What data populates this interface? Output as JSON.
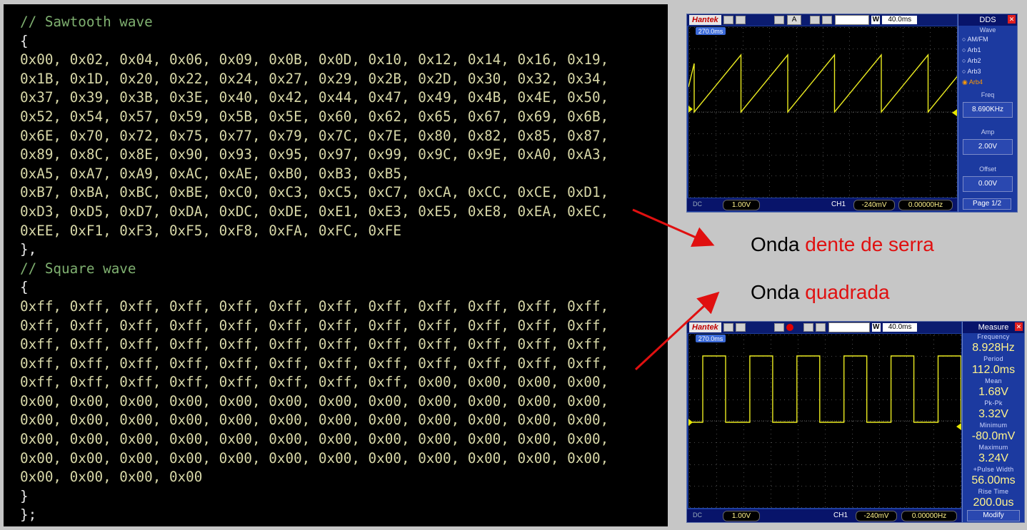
{
  "code": {
    "lines": [
      "// Sawtooth wave",
      "{",
      "0x00, 0x02, 0x04, 0x06, 0x09, 0x0B, 0x0D, 0x10, 0x12, 0x14, 0x16, 0x19,",
      "0x1B, 0x1D, 0x20, 0x22, 0x24, 0x27, 0x29, 0x2B, 0x2D, 0x30, 0x32, 0x34,",
      "0x37, 0x39, 0x3B, 0x3E, 0x40, 0x42, 0x44, 0x47, 0x49, 0x4B, 0x4E, 0x50,",
      "0x52, 0x54, 0x57, 0x59, 0x5B, 0x5E, 0x60, 0x62, 0x65, 0x67, 0x69, 0x6B,",
      "0x6E, 0x70, 0x72, 0x75, 0x77, 0x79, 0x7C, 0x7E, 0x80, 0x82, 0x85, 0x87,",
      "0x89, 0x8C, 0x8E, 0x90, 0x93, 0x95, 0x97, 0x99, 0x9C, 0x9E, 0xA0, 0xA3,",
      "0xA5, 0xA7, 0xA9, 0xAC, 0xAE, 0xB0, 0xB3, 0xB5,",
      "0xB7, 0xBA, 0xBC, 0xBE, 0xC0, 0xC3, 0xC5, 0xC7, 0xCA, 0xCC, 0xCE, 0xD1,",
      "0xD3, 0xD5, 0xD7, 0xDA, 0xDC, 0xDE, 0xE1, 0xE3, 0xE5, 0xE8, 0xEA, 0xEC,",
      "0xEE, 0xF1, 0xF3, 0xF5, 0xF8, 0xFA, 0xFC, 0xFE",
      "},",
      "// Square wave",
      "{",
      "0xff, 0xff, 0xff, 0xff, 0xff, 0xff, 0xff, 0xff, 0xff, 0xff, 0xff, 0xff,",
      "0xff, 0xff, 0xff, 0xff, 0xff, 0xff, 0xff, 0xff, 0xff, 0xff, 0xff, 0xff,",
      "0xff, 0xff, 0xff, 0xff, 0xff, 0xff, 0xff, 0xff, 0xff, 0xff, 0xff, 0xff,",
      "0xff, 0xff, 0xff, 0xff, 0xff, 0xff, 0xff, 0xff, 0xff, 0xff, 0xff, 0xff,",
      "0xff, 0xff, 0xff, 0xff, 0xff, 0xff, 0xff, 0xff, 0x00, 0x00, 0x00, 0x00,",
      "0x00, 0x00, 0x00, 0x00, 0x00, 0x00, 0x00, 0x00, 0x00, 0x00, 0x00, 0x00,",
      "0x00, 0x00, 0x00, 0x00, 0x00, 0x00, 0x00, 0x00, 0x00, 0x00, 0x00, 0x00,",
      "0x00, 0x00, 0x00, 0x00, 0x00, 0x00, 0x00, 0x00, 0x00, 0x00, 0x00, 0x00,",
      "0x00, 0x00, 0x00, 0x00, 0x00, 0x00, 0x00, 0x00, 0x00, 0x00, 0x00, 0x00,",
      "0x00, 0x00, 0x00, 0x00",
      "}",
      "};"
    ]
  },
  "scope_top": {
    "brand": "Hantek",
    "timebase": "40.0ms",
    "trigger_pos": "270.0ms",
    "panel_title": "DDS",
    "wave_label": "Wave",
    "wave_options": [
      "AM/FM",
      "Arb1",
      "Arb2",
      "Arb3",
      "Arb4"
    ],
    "selected_wave": "Arb4",
    "freq_label": "Freq",
    "freq_value": "8.690KHz",
    "amp_label": "Amp",
    "amp_value": "2.00V",
    "offset_label": "Offset",
    "offset_value": "0.00V",
    "page": "Page 1/2",
    "ch_volts": "1.00V",
    "trig_label": "CH1",
    "trig_level": "-240mV",
    "counter": "0.00000Hz",
    "waveform": "sawtooth"
  },
  "scope_bottom": {
    "brand": "Hantek",
    "timebase": "40.0ms",
    "trigger_pos": "270.0ms",
    "panel_title": "Measure",
    "measurements": [
      {
        "label": "Frequency",
        "value": "8.928Hz"
      },
      {
        "label": "Period",
        "value": "112.0ms"
      },
      {
        "label": "Mean",
        "value": "1.68V"
      },
      {
        "label": "Pk-Pk",
        "value": "3.32V"
      },
      {
        "label": "Minimum",
        "value": "-80.0mV"
      },
      {
        "label": "Maximum",
        "value": "3.24V"
      },
      {
        "label": "+Pulse Width",
        "value": "56.00ms"
      },
      {
        "label": "Rise Time",
        "value": "200.0us"
      }
    ],
    "modify": "Modify",
    "ch_volts": "1.00V",
    "trig_label": "CH1",
    "trig_level": "-240mV",
    "counter": "0.00000Hz",
    "waveform": "square"
  },
  "annotations": {
    "sawtooth_prefix": "Onda",
    "sawtooth_highlight": "dente de serra",
    "square_prefix": "Onda",
    "square_highlight": "quadrada",
    "highlight_color": "#e01010",
    "arrow_color": "#e01010"
  }
}
